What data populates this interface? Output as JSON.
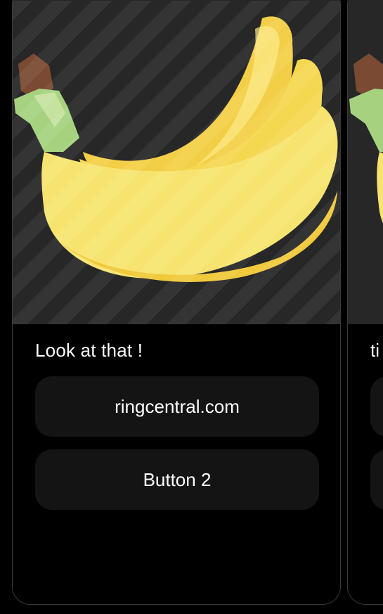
{
  "cards": [
    {
      "title": "Look at that !",
      "image_icon": "banana-icon",
      "buttons": [
        {
          "label": "ringcentral.com"
        },
        {
          "label": "Button 2"
        }
      ]
    },
    {
      "title_visible_fragment": "ti",
      "image_icon": "banana-icon"
    }
  ],
  "colors": {
    "background": "#000000",
    "media_background": "#272727",
    "button_background": "#141414",
    "card_border": "#3a3a3c",
    "text": "#ffffff",
    "banana_main": "#f6e46d",
    "banana_shadow": "#f3cf47",
    "stem_green": "#9fd07a",
    "stem_brown": "#7a4a32"
  }
}
